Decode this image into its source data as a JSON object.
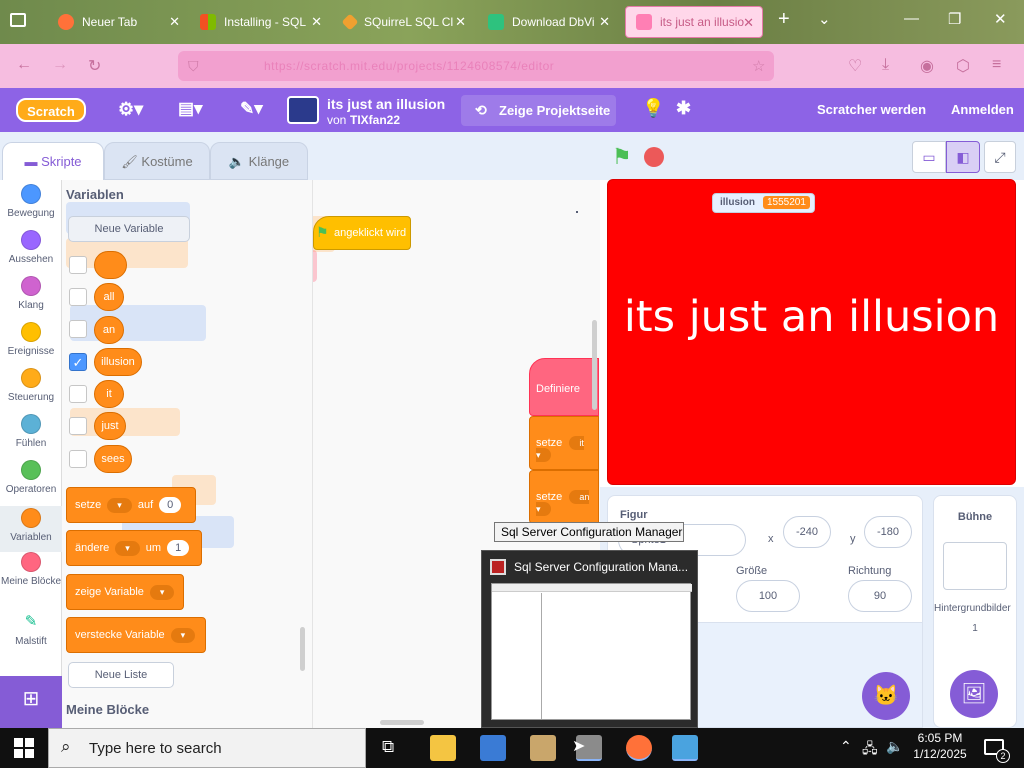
{
  "browser": {
    "tabs": [
      {
        "label": "Neuer Tab",
        "icon": "firefox-icon",
        "color": "#ff7139"
      },
      {
        "label": "Installing - SQL",
        "icon": "microsoft-icon",
        "color": "#f25022"
      },
      {
        "label": "SQuirreL SQL Cl",
        "icon": "squirrel-icon",
        "color": "#f0a030"
      },
      {
        "label": "Download DbVi",
        "icon": "download-icon",
        "color": "#2ec27e"
      },
      {
        "label": "its just an illusio",
        "icon": "scratch-icon",
        "color": "#ff7fb4"
      }
    ],
    "new_tab_symbol": "+",
    "url_text": "https://scratch.mit.edu/projects/1124608574/editor"
  },
  "scratch": {
    "logo": "Scratch",
    "project_title": "its just an illusion",
    "author_prefix": "von",
    "author": "TIXfan22",
    "share_label": "Zeige Projektseite",
    "join_label": "Scratcher werden",
    "signin_label": "Anmelden",
    "tabs": {
      "code": "Skripte",
      "costumes": "Kostüme",
      "sounds": "Klänge"
    },
    "categories": [
      {
        "label": "Bewegung",
        "color": "#4c97ff"
      },
      {
        "label": "Aussehen",
        "color": "#9966ff"
      },
      {
        "label": "Klang",
        "color": "#cf63cf"
      },
      {
        "label": "Ereignisse",
        "color": "#ffbf00"
      },
      {
        "label": "Steuerung",
        "color": "#ffab19"
      },
      {
        "label": "Fühlen",
        "color": "#5cb1d6"
      },
      {
        "label": "Operatoren",
        "color": "#59c059"
      },
      {
        "label": "Variablen",
        "color": "#ff8c1a"
      },
      {
        "label": "Meine Blöcke",
        "color": "#ff6680"
      },
      {
        "label": "Malstift",
        "color": "#0fbd8c"
      }
    ],
    "palette": {
      "section_title": "Variablen",
      "new_variable": "Neue Variable",
      "variables": [
        {
          "name": "",
          "checked": false
        },
        {
          "name": "all",
          "checked": false
        },
        {
          "name": "an",
          "checked": false
        },
        {
          "name": "illusion",
          "checked": true
        },
        {
          "name": "it",
          "checked": false
        },
        {
          "name": "just",
          "checked": false
        },
        {
          "name": "sees",
          "checked": false
        }
      ],
      "set_block": {
        "label": "setze",
        "to": "auf",
        "value": "0"
      },
      "change_block": {
        "label": "ändere",
        "by": "um",
        "value": "1"
      },
      "show_block": "zeige Variable",
      "hide_block": "verstecke Variable",
      "new_list": "Neue Liste",
      "myblocks_title": "Meine Blöcke"
    },
    "workspace": {
      "hat_label": "angeklickt wird",
      "define_label": "Definiere",
      "set_it": {
        "label": "setze",
        "var": "it"
      },
      "set_an": {
        "label": "setze",
        "var": "an"
      }
    },
    "stage": {
      "monitor_label": "illusion",
      "monitor_value": "1555201",
      "text": "its just an illusion",
      "background_color": "#ff0000"
    },
    "sprite_info": {
      "sprite_label": "Figur",
      "sprite_name": "Sprite1",
      "x_label": "x",
      "x_value": "-240",
      "y_label": "y",
      "y_value": "-180",
      "size_label": "Größe",
      "size_value": "100",
      "direction_label": "Richtung",
      "direction_value": "90"
    },
    "stage_panel": {
      "title": "Bühne",
      "backdrops_label": "Hintergrundbilder",
      "backdrops_count": "1"
    }
  },
  "taskbar_popup": {
    "tooltip": "Sql Server Configuration Manager",
    "preview_title": "Sql Server Configuration Mana..."
  },
  "taskbar": {
    "search_placeholder": "Type here to search",
    "time": "6:05 PM",
    "date": "1/12/2025",
    "notification_count": "2"
  }
}
